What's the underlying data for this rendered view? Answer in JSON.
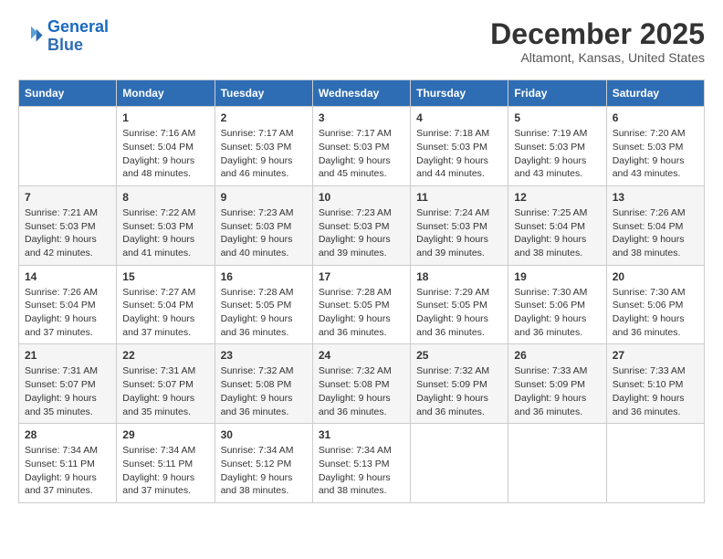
{
  "header": {
    "logo_line1": "General",
    "logo_line2": "Blue",
    "month_year": "December 2025",
    "location": "Altamont, Kansas, United States"
  },
  "columns": [
    "Sunday",
    "Monday",
    "Tuesday",
    "Wednesday",
    "Thursday",
    "Friday",
    "Saturday"
  ],
  "weeks": [
    [
      {
        "day": "",
        "info": ""
      },
      {
        "day": "1",
        "info": "Sunrise: 7:16 AM\nSunset: 5:04 PM\nDaylight: 9 hours\nand 48 minutes."
      },
      {
        "day": "2",
        "info": "Sunrise: 7:17 AM\nSunset: 5:03 PM\nDaylight: 9 hours\nand 46 minutes."
      },
      {
        "day": "3",
        "info": "Sunrise: 7:17 AM\nSunset: 5:03 PM\nDaylight: 9 hours\nand 45 minutes."
      },
      {
        "day": "4",
        "info": "Sunrise: 7:18 AM\nSunset: 5:03 PM\nDaylight: 9 hours\nand 44 minutes."
      },
      {
        "day": "5",
        "info": "Sunrise: 7:19 AM\nSunset: 5:03 PM\nDaylight: 9 hours\nand 43 minutes."
      },
      {
        "day": "6",
        "info": "Sunrise: 7:20 AM\nSunset: 5:03 PM\nDaylight: 9 hours\nand 43 minutes."
      }
    ],
    [
      {
        "day": "7",
        "info": "Sunrise: 7:21 AM\nSunset: 5:03 PM\nDaylight: 9 hours\nand 42 minutes."
      },
      {
        "day": "8",
        "info": "Sunrise: 7:22 AM\nSunset: 5:03 PM\nDaylight: 9 hours\nand 41 minutes."
      },
      {
        "day": "9",
        "info": "Sunrise: 7:23 AM\nSunset: 5:03 PM\nDaylight: 9 hours\nand 40 minutes."
      },
      {
        "day": "10",
        "info": "Sunrise: 7:23 AM\nSunset: 5:03 PM\nDaylight: 9 hours\nand 39 minutes."
      },
      {
        "day": "11",
        "info": "Sunrise: 7:24 AM\nSunset: 5:03 PM\nDaylight: 9 hours\nand 39 minutes."
      },
      {
        "day": "12",
        "info": "Sunrise: 7:25 AM\nSunset: 5:04 PM\nDaylight: 9 hours\nand 38 minutes."
      },
      {
        "day": "13",
        "info": "Sunrise: 7:26 AM\nSunset: 5:04 PM\nDaylight: 9 hours\nand 38 minutes."
      }
    ],
    [
      {
        "day": "14",
        "info": "Sunrise: 7:26 AM\nSunset: 5:04 PM\nDaylight: 9 hours\nand 37 minutes."
      },
      {
        "day": "15",
        "info": "Sunrise: 7:27 AM\nSunset: 5:04 PM\nDaylight: 9 hours\nand 37 minutes."
      },
      {
        "day": "16",
        "info": "Sunrise: 7:28 AM\nSunset: 5:05 PM\nDaylight: 9 hours\nand 36 minutes."
      },
      {
        "day": "17",
        "info": "Sunrise: 7:28 AM\nSunset: 5:05 PM\nDaylight: 9 hours\nand 36 minutes."
      },
      {
        "day": "18",
        "info": "Sunrise: 7:29 AM\nSunset: 5:05 PM\nDaylight: 9 hours\nand 36 minutes."
      },
      {
        "day": "19",
        "info": "Sunrise: 7:30 AM\nSunset: 5:06 PM\nDaylight: 9 hours\nand 36 minutes."
      },
      {
        "day": "20",
        "info": "Sunrise: 7:30 AM\nSunset: 5:06 PM\nDaylight: 9 hours\nand 36 minutes."
      }
    ],
    [
      {
        "day": "21",
        "info": "Sunrise: 7:31 AM\nSunset: 5:07 PM\nDaylight: 9 hours\nand 35 minutes."
      },
      {
        "day": "22",
        "info": "Sunrise: 7:31 AM\nSunset: 5:07 PM\nDaylight: 9 hours\nand 35 minutes."
      },
      {
        "day": "23",
        "info": "Sunrise: 7:32 AM\nSunset: 5:08 PM\nDaylight: 9 hours\nand 36 minutes."
      },
      {
        "day": "24",
        "info": "Sunrise: 7:32 AM\nSunset: 5:08 PM\nDaylight: 9 hours\nand 36 minutes."
      },
      {
        "day": "25",
        "info": "Sunrise: 7:32 AM\nSunset: 5:09 PM\nDaylight: 9 hours\nand 36 minutes."
      },
      {
        "day": "26",
        "info": "Sunrise: 7:33 AM\nSunset: 5:09 PM\nDaylight: 9 hours\nand 36 minutes."
      },
      {
        "day": "27",
        "info": "Sunrise: 7:33 AM\nSunset: 5:10 PM\nDaylight: 9 hours\nand 36 minutes."
      }
    ],
    [
      {
        "day": "28",
        "info": "Sunrise: 7:34 AM\nSunset: 5:11 PM\nDaylight: 9 hours\nand 37 minutes."
      },
      {
        "day": "29",
        "info": "Sunrise: 7:34 AM\nSunset: 5:11 PM\nDaylight: 9 hours\nand 37 minutes."
      },
      {
        "day": "30",
        "info": "Sunrise: 7:34 AM\nSunset: 5:12 PM\nDaylight: 9 hours\nand 38 minutes."
      },
      {
        "day": "31",
        "info": "Sunrise: 7:34 AM\nSunset: 5:13 PM\nDaylight: 9 hours\nand 38 minutes."
      },
      {
        "day": "",
        "info": ""
      },
      {
        "day": "",
        "info": ""
      },
      {
        "day": "",
        "info": ""
      }
    ]
  ]
}
